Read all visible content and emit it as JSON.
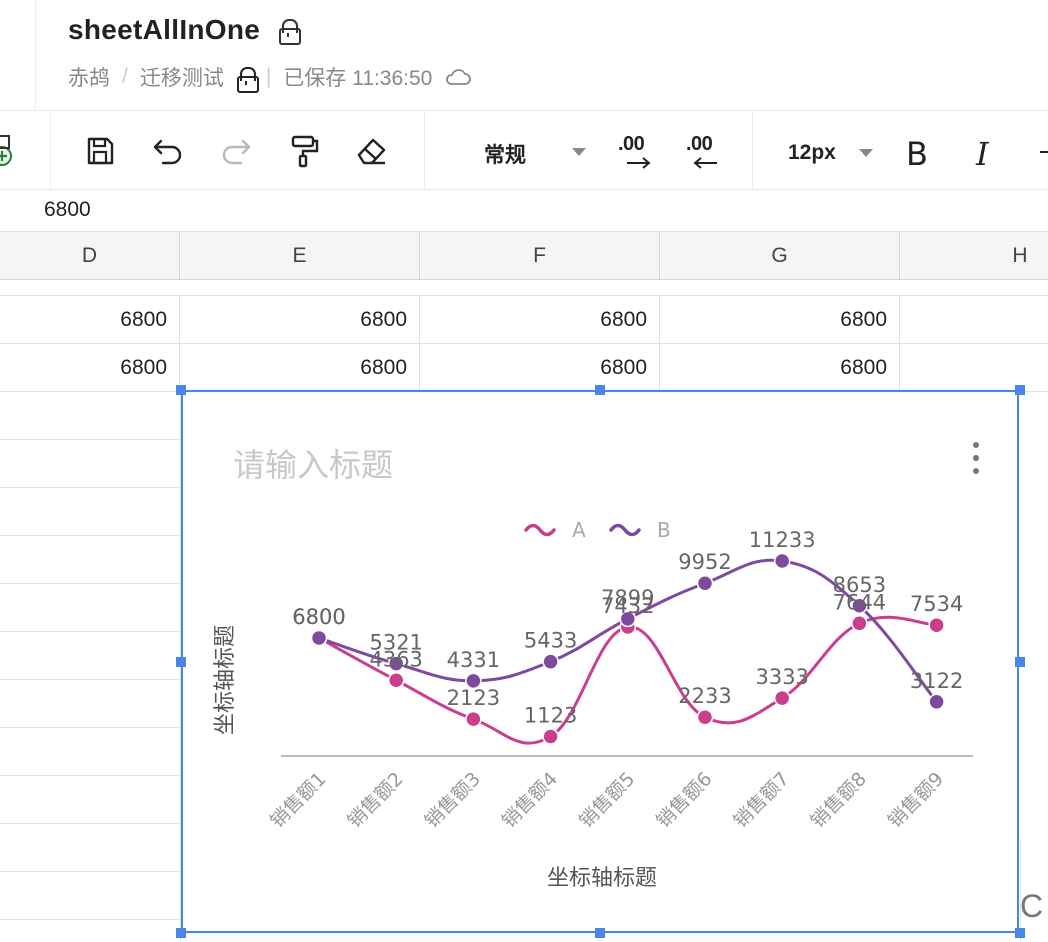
{
  "header": {
    "title": "sheetAllInOne",
    "breadcrumb": [
      "赤鸪",
      "迁移测试"
    ],
    "breadcrumb_sep": "/",
    "save_status": "已保存 11:36:50",
    "status_sep": "|"
  },
  "toolbar": {
    "icons": [
      "add-icon",
      "save-icon",
      "undo-icon",
      "redo-icon",
      "format-painter-icon",
      "eraser-icon"
    ],
    "number_format": "常规",
    "decrease_decimal_label": ".00",
    "increase_decimal_label": ".00",
    "font_size": "12px",
    "bold_label": "B",
    "italic_label": "I"
  },
  "formula_bar": {
    "value": "6800"
  },
  "grid": {
    "columns": [
      "D",
      "E",
      "F",
      "G",
      "H"
    ],
    "rows": [
      [
        "6800",
        "6800",
        "6800",
        "6800",
        ""
      ],
      [
        "6800",
        "6800",
        "6800",
        "6800",
        ""
      ]
    ]
  },
  "chart_data": {
    "type": "line",
    "smooth": true,
    "title": "请输入标题",
    "xlabel": "坐标轴标题",
    "ylabel": "坐标轴标题",
    "categories": [
      "销售额1",
      "销售额2",
      "销售额3",
      "销售额4",
      "销售额5",
      "销售额6",
      "销售额7",
      "销售额8",
      "销售额9"
    ],
    "series": [
      {
        "name": "A",
        "color": "#c93f8e",
        "values": [
          6800,
          4363,
          2123,
          1123,
          7432,
          2233,
          3333,
          7644,
          7534
        ]
      },
      {
        "name": "B",
        "color": "#7e4aa0",
        "values": [
          6800,
          5321,
          4331,
          5433,
          7899,
          9952,
          11233,
          8653,
          3122
        ]
      }
    ],
    "ylim": [
      0,
      13000
    ],
    "legend": "top-center",
    "grid": false
  },
  "corner_text": "C"
}
